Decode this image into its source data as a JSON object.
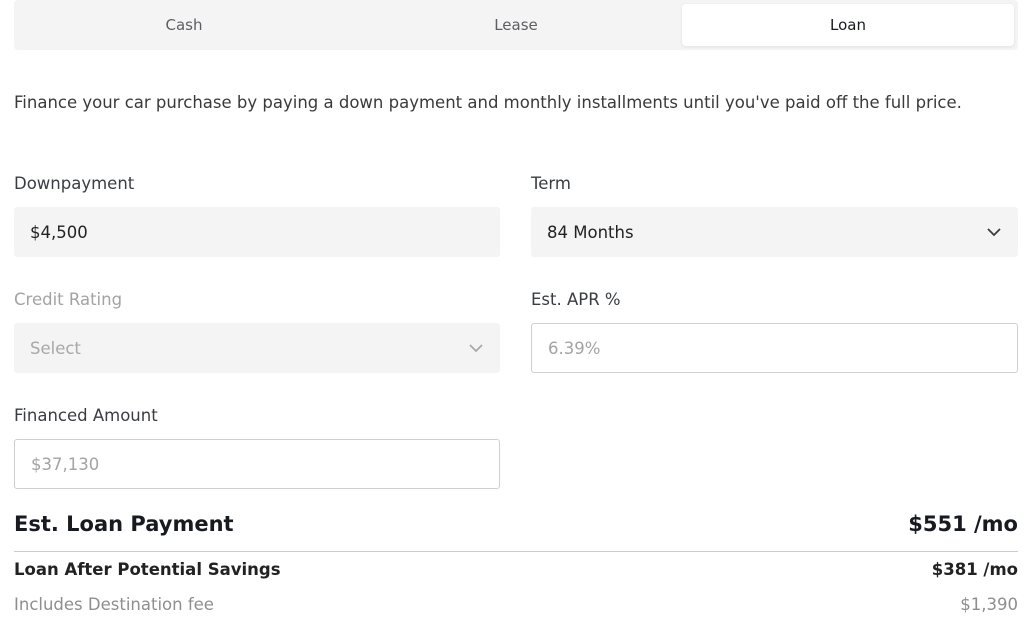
{
  "tabs": [
    {
      "label": "Cash",
      "active": false
    },
    {
      "label": "Lease",
      "active": false
    },
    {
      "label": "Loan",
      "active": true
    }
  ],
  "description": "Finance your car purchase by paying a down payment and monthly installments until you've paid off the full price.",
  "downpayment": {
    "label": "Downpayment",
    "value": "$4,500"
  },
  "term": {
    "label": "Term",
    "value": "84 Months"
  },
  "credit_rating": {
    "label": "Credit Rating",
    "value": "Select",
    "disabled": true
  },
  "apr": {
    "label": "Est. APR %",
    "value": "6.39%"
  },
  "financed_amount": {
    "label": "Financed Amount",
    "value": "$37,130"
  },
  "loan_payment": {
    "label": "Est. Loan Payment",
    "value": "$551 /mo"
  },
  "savings": {
    "label": "Loan After Potential Savings",
    "value": "$381 /mo"
  },
  "destination_fee": {
    "label": "Includes Destination fee",
    "value": "$1,390"
  },
  "colors": {
    "tab_background": "#f4f4f4",
    "field_background": "#f4f4f4",
    "text_primary": "#171a20",
    "text_muted": "#a3a3a3",
    "border": "#cfcfcf"
  },
  "icons": {
    "dropdown": "chevron-down-icon"
  }
}
